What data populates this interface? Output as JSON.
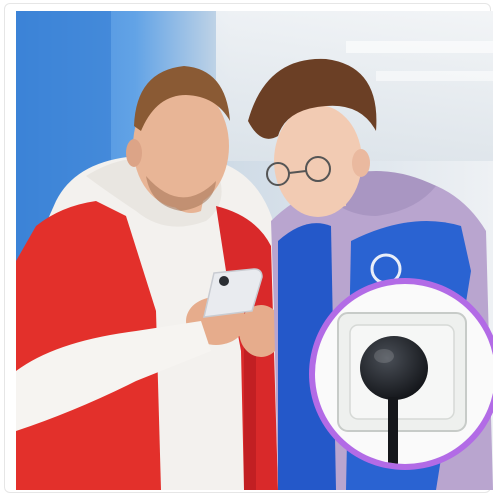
{
  "image": {
    "subject": "",
    "badge": {
      "icon": "power-plug-icon",
      "ring_color": "#b26be6",
      "socket_color": "#eef0ee",
      "plug_color": "#1a1d22"
    },
    "colors": {
      "left_vest": "#e3302b",
      "left_hoodie": "#f3f1ee",
      "right_hoodie": "#b9a5cf",
      "right_vest": "#2458c9",
      "wall_blue": "#4f8fdc",
      "background_light": "#e8edf2"
    }
  }
}
